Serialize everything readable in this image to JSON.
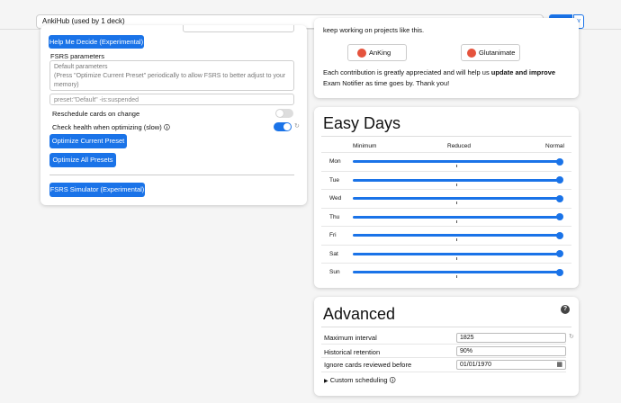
{
  "topbar": {
    "preset_value": "AnkiHub (used by 1 deck)",
    "save_label": "Save"
  },
  "left": {
    "help_me_decide": "Help Me Decide (Experimental)",
    "fsrs_params_label": "FSRS parameters",
    "params_placeholder": "Default parameters\n(Press \"Optimize Current Preset\" periodically to allow FSRS to better adjust to your memory)",
    "search_value": "preset:\"Default\" -is:suspended",
    "reschedule_label": "Reschedule cards on change",
    "reschedule_on": false,
    "health_label": "Check health when optimizing (slow)",
    "health_on": true,
    "optimize_current": "Optimize Current Preset",
    "optimize_all": "Optimize All Presets",
    "simulator": "FSRS Simulator (Experimental)"
  },
  "contrib": {
    "top_text": "keep working on projects like this.",
    "btn1": "AnKing",
    "btn2": "Glutanimate",
    "body_pre": "Each contribution is greatly appreciated and will help us ",
    "body_bold": "update and improve",
    "body_post": " Exam Notifier as time goes by. Thank you!"
  },
  "easy_days": {
    "title": "Easy Days",
    "col_min": "Minimum",
    "col_reduced": "Reduced",
    "col_normal": "Normal",
    "days": [
      {
        "label": "Mon",
        "value": 1.0
      },
      {
        "label": "Tue",
        "value": 1.0
      },
      {
        "label": "Wed",
        "value": 1.0
      },
      {
        "label": "Thu",
        "value": 1.0
      },
      {
        "label": "Fri",
        "value": 1.0
      },
      {
        "label": "Sat",
        "value": 1.0
      },
      {
        "label": "Sun",
        "value": 1.0
      }
    ]
  },
  "advanced": {
    "title": "Advanced",
    "max_interval_label": "Maximum interval",
    "max_interval_value": "1825",
    "hist_retention_label": "Historical retention",
    "hist_retention_value": "90%",
    "ignore_label": "Ignore cards reviewed before",
    "ignore_value": "01/01/1970",
    "custom_label": "Custom scheduling"
  },
  "colors": {
    "accent": "#1a73e8",
    "text": "#111111"
  }
}
